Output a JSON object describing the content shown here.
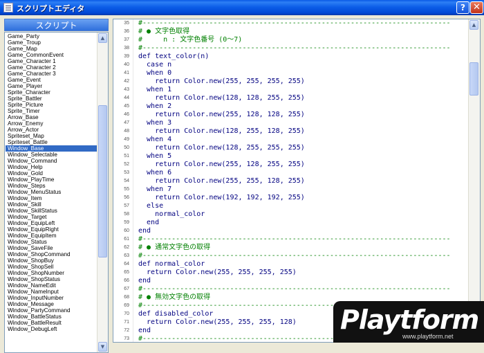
{
  "window": {
    "title": "スクリプトエディタ",
    "help_label": "?",
    "close_label": "✕"
  },
  "script_list": {
    "header": "スクリプト",
    "items": [
      "Game_Party",
      "Game_Troup",
      "Game_Map",
      "Game_CommonEvent",
      "Game_Character 1",
      "Game_Character 2",
      "Game_Character 3",
      "Game_Event",
      "Game_Player",
      "Sprite_Character",
      "Sprite_Battler",
      "Sprite_Picture",
      "Sprite_Timer",
      "Arrow_Base",
      "Arrow_Enemy",
      "Arrow_Actor",
      "Spriteset_Map",
      "Spriteset_Battle",
      "Window_Base",
      "Window_Selectable",
      "Window_Command",
      "Window_Help",
      "Window_Gold",
      "Window_PlayTime",
      "Window_Steps",
      "Window_MenuStatus",
      "Window_Item",
      "Window_Skill",
      "Window_SkillStatus",
      "Window_Target",
      "Window_EquipLeft",
      "Window_EquipRight",
      "Window_EquipItem",
      "Window_Status",
      "Window_SaveFile",
      "Window_ShopCommand",
      "Window_ShopBuy",
      "Window_ShopSell",
      "Window_ShopNumber",
      "Window_ShopStatus",
      "Window_NameEdit",
      "Window_NameInput",
      "Window_InputNumber",
      "Window_Message",
      "Window_PartyCommand",
      "Window_BattleStatus",
      "Window_BattleResult",
      "Window_DebugLeft"
    ],
    "selected": "Window_Base"
  },
  "editor": {
    "lines": [
      {
        "n": "35",
        "t": "#--------------------------------------------------------------------------",
        "k": "comment"
      },
      {
        "n": "36",
        "t": "# ● 文字色取得",
        "k": "comment"
      },
      {
        "n": "37",
        "t": "#     n : 文字色番号 (0～7)",
        "k": "comment"
      },
      {
        "n": "38",
        "t": "#--------------------------------------------------------------------------",
        "k": "comment"
      },
      {
        "n": "39",
        "t": "def text_color(n)",
        "k": "code"
      },
      {
        "n": "40",
        "t": "  case n",
        "k": "code"
      },
      {
        "n": "41",
        "t": "  when 0",
        "k": "code"
      },
      {
        "n": "42",
        "t": "    return Color.new(255, 255, 255, 255)",
        "k": "code"
      },
      {
        "n": "43",
        "t": "  when 1",
        "k": "code"
      },
      {
        "n": "44",
        "t": "    return Color.new(128, 128, 255, 255)",
        "k": "code"
      },
      {
        "n": "45",
        "t": "  when 2",
        "k": "code"
      },
      {
        "n": "46",
        "t": "    return Color.new(255, 128, 128, 255)",
        "k": "code"
      },
      {
        "n": "47",
        "t": "  when 3",
        "k": "code"
      },
      {
        "n": "48",
        "t": "    return Color.new(128, 255, 128, 255)",
        "k": "code"
      },
      {
        "n": "49",
        "t": "  when 4",
        "k": "code"
      },
      {
        "n": "50",
        "t": "    return Color.new(128, 255, 255, 255)",
        "k": "code"
      },
      {
        "n": "51",
        "t": "  when 5",
        "k": "code"
      },
      {
        "n": "52",
        "t": "    return Color.new(255, 128, 255, 255)",
        "k": "code"
      },
      {
        "n": "53",
        "t": "  when 6",
        "k": "code"
      },
      {
        "n": "54",
        "t": "    return Color.new(255, 255, 128, 255)",
        "k": "code"
      },
      {
        "n": "55",
        "t": "  when 7",
        "k": "code"
      },
      {
        "n": "56",
        "t": "    return Color.new(192, 192, 192, 255)",
        "k": "code"
      },
      {
        "n": "57",
        "t": "  else",
        "k": "code"
      },
      {
        "n": "58",
        "t": "    normal_color",
        "k": "code"
      },
      {
        "n": "59",
        "t": "  end",
        "k": "code"
      },
      {
        "n": "60",
        "t": "end",
        "k": "code"
      },
      {
        "n": "61",
        "t": "#--------------------------------------------------------------------------",
        "k": "comment"
      },
      {
        "n": "62",
        "t": "# ● 通常文字色の取得",
        "k": "comment"
      },
      {
        "n": "63",
        "t": "#--------------------------------------------------------------------------",
        "k": "comment"
      },
      {
        "n": "64",
        "t": "def normal_color",
        "k": "code"
      },
      {
        "n": "65",
        "t": "  return Color.new(255, 255, 255, 255)",
        "k": "code"
      },
      {
        "n": "66",
        "t": "end",
        "k": "code"
      },
      {
        "n": "67",
        "t": "#--------------------------------------------------------------------------",
        "k": "comment"
      },
      {
        "n": "68",
        "t": "# ● 無効文字色の取得",
        "k": "comment"
      },
      {
        "n": "69",
        "t": "#--------------------------------------------------------------------------",
        "k": "comment"
      },
      {
        "n": "70",
        "t": "def disabled_color",
        "k": "code"
      },
      {
        "n": "71",
        "t": "  return Color.new(255, 255, 255, 128)",
        "k": "code"
      },
      {
        "n": "72",
        "t": "end",
        "k": "code"
      },
      {
        "n": "73",
        "t": "#--------------------------------------------------------------------------",
        "k": "comment"
      }
    ]
  },
  "watermark": {
    "brand": "Playtform",
    "url": "www.playtform.net"
  },
  "colors": {
    "comment": "#008000",
    "code": "#000080",
    "selection": "#316ac5",
    "titlebar": "#0054e3"
  }
}
